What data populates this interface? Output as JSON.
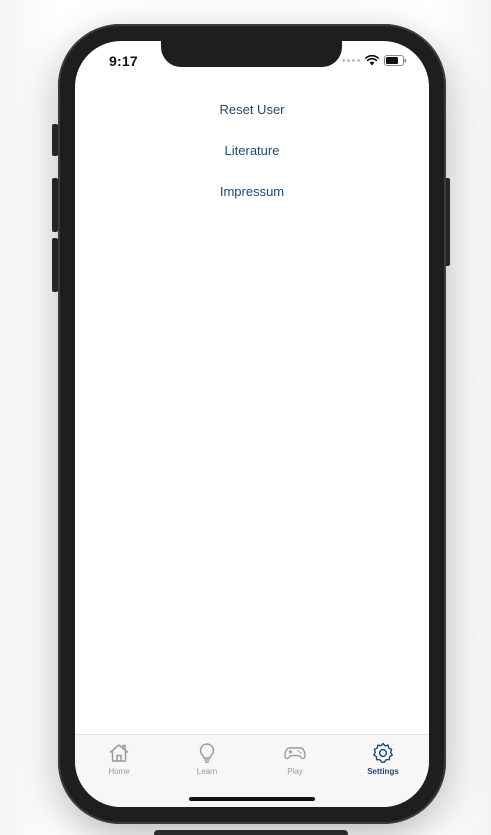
{
  "status_bar": {
    "time": "9:17",
    "signal_icon": "cellular-dots-icon",
    "wifi_icon": "wifi-icon",
    "battery_icon": "battery-icon"
  },
  "settings_menu": {
    "items": [
      {
        "label": "Reset User"
      },
      {
        "label": "Literature"
      },
      {
        "label": "Impressum"
      }
    ]
  },
  "tab_bar": {
    "tabs": [
      {
        "label": "Home",
        "icon": "home-icon",
        "active": false
      },
      {
        "label": "Learn",
        "icon": "lightbulb-icon",
        "active": false
      },
      {
        "label": "Play",
        "icon": "gamepad-icon",
        "active": false
      },
      {
        "label": "Settings",
        "icon": "gear-icon",
        "active": true
      }
    ]
  },
  "colors": {
    "accent": "#1b4a7a",
    "inactive": "#9a9a9a",
    "device_frame": "#1e1e1e"
  }
}
